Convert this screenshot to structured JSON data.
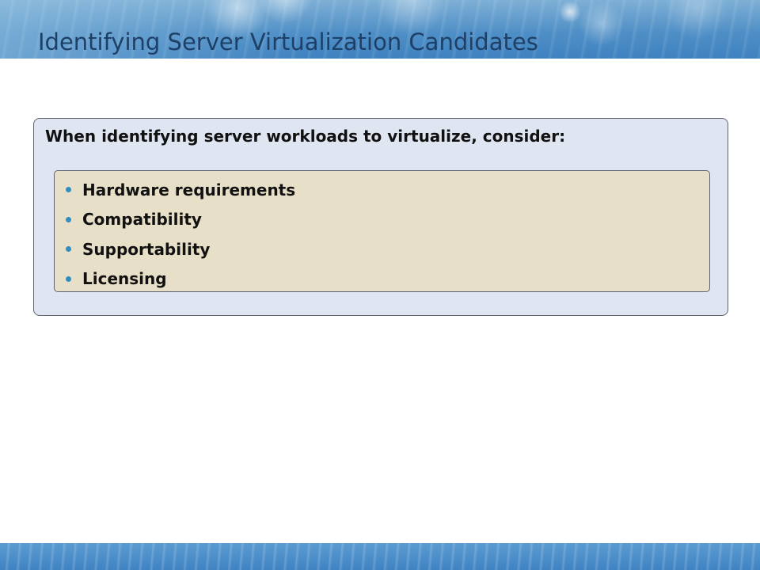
{
  "slide": {
    "title": "Identifying Server Virtualization Candidates"
  },
  "panel": {
    "heading": "When identifying server workloads to virtualize, consider:",
    "items": [
      {
        "label": "Hardware requirements"
      },
      {
        "label": "Compatibility"
      },
      {
        "label": "Supportability"
      },
      {
        "label": "Licensing"
      }
    ]
  },
  "colors": {
    "title_text": "#1e3f66",
    "outer_panel_bg": "#dfe6f1",
    "inner_panel_bg": "#e8dfc8",
    "bullet": "#2d8fc4",
    "banner_blue": "#4f8fc6"
  }
}
